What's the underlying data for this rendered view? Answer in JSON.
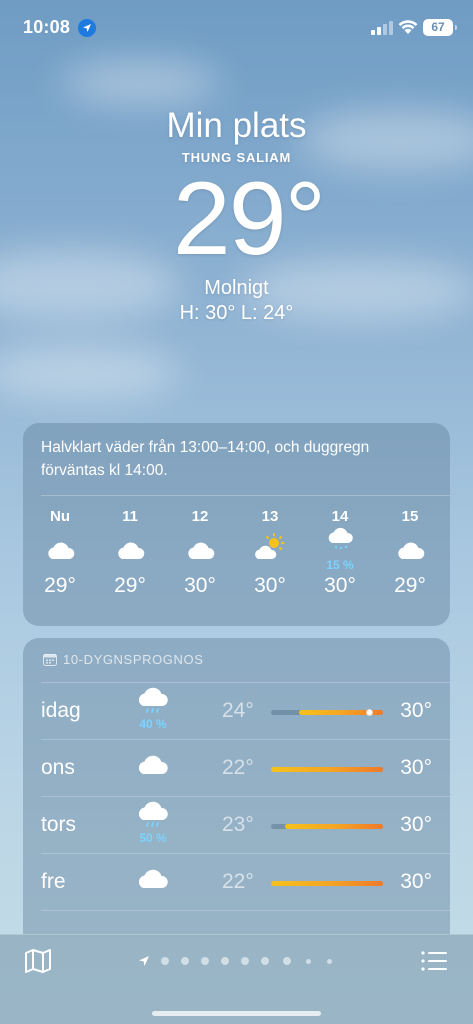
{
  "status_bar": {
    "time": "10:08",
    "battery": "67",
    "icons": [
      "location-arrow-icon",
      "cellular-signal-icon",
      "wifi-icon",
      "battery-icon"
    ]
  },
  "header": {
    "location": "Min plats",
    "place": "THUNG SALIAM",
    "temperature": "29°",
    "condition": "Molnigt",
    "hilo": "H: 30°  L: 24°"
  },
  "hourly": {
    "summary": "Halvklart väder från 13:00–14:00, och duggregn förväntas kl 14:00.",
    "hours": [
      {
        "label": "Nu",
        "icon": "cloud-icon",
        "temp": "29°",
        "precip": ""
      },
      {
        "label": "11",
        "icon": "cloud-icon",
        "temp": "29°",
        "precip": ""
      },
      {
        "label": "12",
        "icon": "cloud-icon",
        "temp": "30°",
        "precip": ""
      },
      {
        "label": "13",
        "icon": "partly-sunny-icon",
        "temp": "30°",
        "precip": ""
      },
      {
        "label": "14",
        "icon": "cloud-drizzle-icon",
        "temp": "30°",
        "precip": "15 %"
      },
      {
        "label": "15",
        "icon": "cloud-icon",
        "temp": "29°",
        "precip": ""
      }
    ]
  },
  "daily": {
    "title": "10-DYGNSPROGNOS",
    "scale": {
      "min": 22,
      "max": 30
    },
    "days": [
      {
        "name": "idag",
        "icon": "cloud-rain-icon",
        "precip": "40 %",
        "low": "24°",
        "high": "30°",
        "low_val": 24,
        "high_val": 30,
        "current_val": 29
      },
      {
        "name": "ons",
        "icon": "cloud-icon",
        "precip": "",
        "low": "22°",
        "high": "30°",
        "low_val": 22,
        "high_val": 30
      },
      {
        "name": "tors",
        "icon": "cloud-rain-icon",
        "precip": "50 %",
        "low": "23°",
        "high": "30°",
        "low_val": 23,
        "high_val": 30
      },
      {
        "name": "fre",
        "icon": "cloud-icon",
        "precip": "",
        "low": "22°",
        "high": "30°",
        "low_val": 22,
        "high_val": 30
      }
    ]
  },
  "colors": {
    "accent_precip": "#7cd3ff",
    "range_start": "#f6c21c",
    "range_end": "#f07a2a",
    "sun": "#f7c31a"
  },
  "bottom_bar": {
    "left_icon": "map-icon",
    "right_icon": "list-icon",
    "pages": 10
  }
}
